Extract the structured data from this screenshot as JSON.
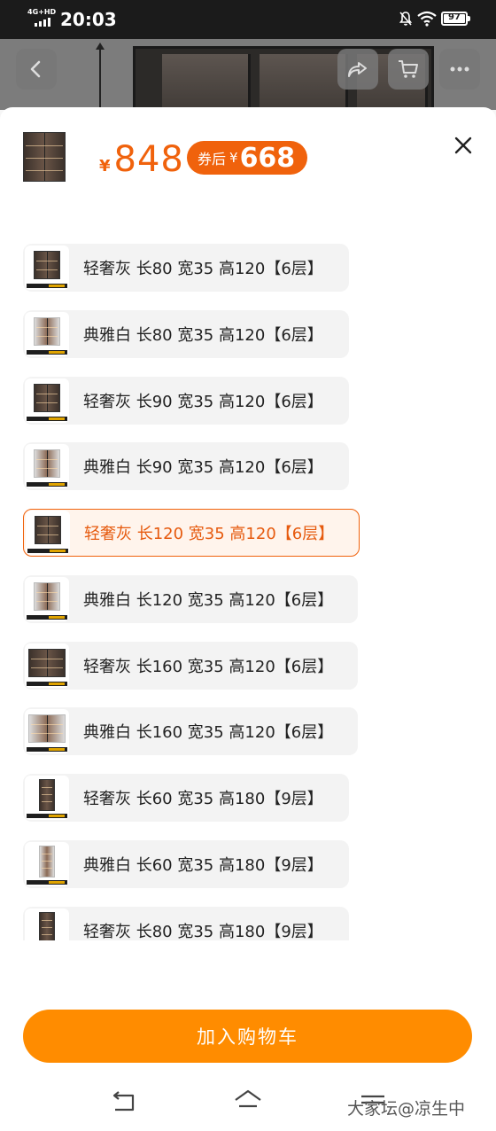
{
  "status_bar": {
    "network": "4G+HD",
    "time": "20:03",
    "battery": "97"
  },
  "colors": {
    "accent_orange": "#f0620c",
    "cart_button": "#ff8c00",
    "status_bar_bg": "#1b1b1b"
  },
  "sheet": {
    "price_symbol": "¥",
    "price": "848",
    "coupon_label": "券后",
    "coupon_symbol": "¥",
    "coupon_price": "668",
    "close_icon": "close-icon"
  },
  "options": [
    {
      "label": "轻奢灰 长80 宽35 高120【6层】",
      "selected": false
    },
    {
      "label": "典雅白 长80 宽35 高120【6层】",
      "selected": false
    },
    {
      "label": "轻奢灰 长90 宽35 高120【6层】",
      "selected": false
    },
    {
      "label": "典雅白 长90 宽35 高120【6层】",
      "selected": false
    },
    {
      "label": "轻奢灰 长120 宽35 高120【6层】",
      "selected": true
    },
    {
      "label": "典雅白 长120 宽35 高120【6层】",
      "selected": false
    },
    {
      "label": "轻奢灰 长160 宽35 高120【6层】",
      "selected": false
    },
    {
      "label": "典雅白 长160 宽35 高120【6层】",
      "selected": false
    },
    {
      "label": "轻奢灰 长60 宽35 高180【9层】",
      "selected": false
    },
    {
      "label": "典雅白 长60 宽35 高180【9层】",
      "selected": false
    },
    {
      "label": "轻奢灰 长80 宽35 高180【9层】",
      "selected": false
    }
  ],
  "cart_button_label": "加入购物车",
  "watermark": "大家坛@凉生中"
}
